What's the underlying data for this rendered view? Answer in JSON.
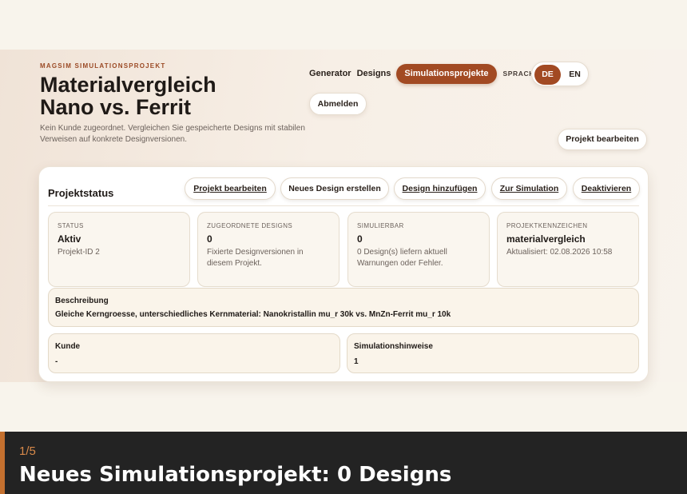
{
  "header": {
    "eyebrow": "MAGSIM SIMULATIONSPROJEKT",
    "title_line1": "Materialvergleich",
    "title_line2": "Nano vs. Ferrit",
    "subtitle": "Kein Kunde zugeordnet. Vergleichen Sie gespeicherte Designs mit stabilen Verweisen auf konkrete Designversionen."
  },
  "nav": {
    "generator": "Generator",
    "designs": "Designs",
    "simulation_projects": "Simulationsprojekte",
    "language_label": "SPRACHE",
    "lang_de": "DE",
    "lang_en": "EN",
    "logout": "Abmelden",
    "edit_project": "Projekt bearbeiten"
  },
  "card": {
    "title": "Projektstatus",
    "actions": {
      "edit": "Projekt bearbeiten",
      "new_design": "Neues Design erstellen",
      "add_design": "Design hinzufügen",
      "to_simulation": "Zur Simulation",
      "deactivate": "Deaktivieren"
    },
    "stats": {
      "status": {
        "label": "Status",
        "value": "Aktiv",
        "note": "Projekt-ID 2"
      },
      "designs": {
        "label": "Zugeordnete Designs",
        "value": "0",
        "note": "Fixierte Designversionen in diesem Projekt."
      },
      "simulatable": {
        "label": "Simulierbar",
        "value": "0",
        "note": "0 Design(s) liefern aktuell Warnungen oder Fehler."
      },
      "identifier": {
        "label": "Projektkennzeichen",
        "value": "materialvergleich",
        "note": "Aktualisiert: 02.08.2026 10:58"
      }
    },
    "description": {
      "label": "Beschreibung",
      "value": "Gleiche Kerngroesse, unterschiedliches Kernmaterial: Nanokristallin mu_r 30k vs. MnZn-Ferrit mu_r 10k"
    },
    "customer": {
      "label": "Kunde",
      "value": "-"
    },
    "simulation_notes": {
      "label": "Simulationshinweise",
      "value": "1"
    }
  },
  "caption": {
    "step": "1/5",
    "title": "Neues Simulationsprojekt: 0 Designs"
  },
  "colors": {
    "accent": "#a24a23",
    "caption_bar": "#c4702f",
    "caption_bg": "#232323"
  }
}
